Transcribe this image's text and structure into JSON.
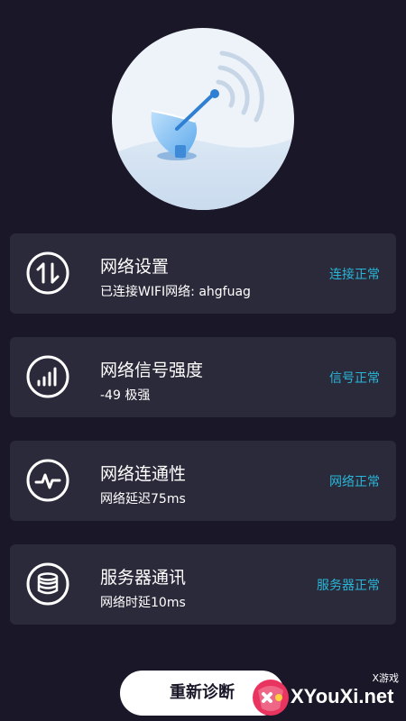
{
  "hero": {
    "illustration": "satellite-dish-icon"
  },
  "cards": [
    {
      "icon": "arrows-updown-icon",
      "title": "网络设置",
      "subtitle": "已连接WIFI网络: ahgfuag",
      "status": "连接正常"
    },
    {
      "icon": "signal-bars-icon",
      "title": "网络信号强度",
      "subtitle": "-49 极强",
      "status": "信号正常"
    },
    {
      "icon": "pulse-icon",
      "title": "网络连通性",
      "subtitle": "网络延迟75ms",
      "status": "网络正常"
    },
    {
      "icon": "database-icon",
      "title": "服务器通讯",
      "subtitle": "网络时延10ms",
      "status": "服务器正常"
    }
  ],
  "actions": {
    "rediagnose_label": "重新诊断"
  },
  "watermark": {
    "small": "X游戏",
    "brand": "XYouXi.net"
  },
  "colors": {
    "background": "#1a1728",
    "card": "#2b2a3a",
    "status": "#29b6d8"
  }
}
